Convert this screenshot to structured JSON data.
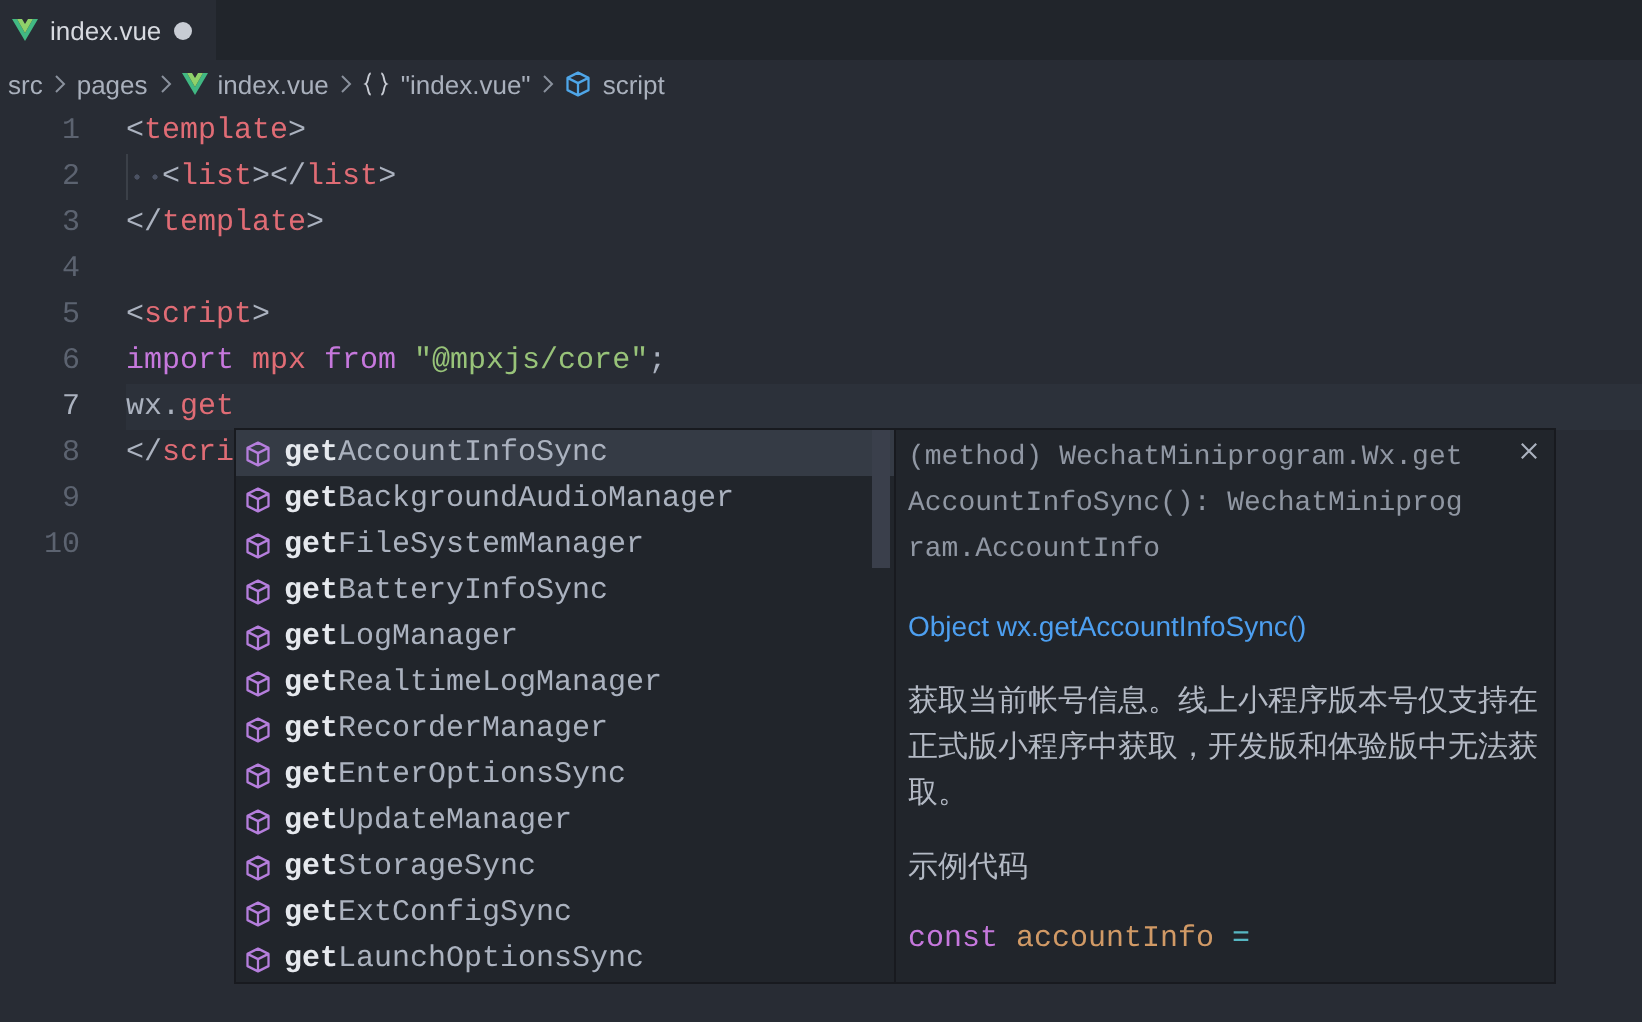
{
  "tabs": [
    {
      "label": "index.vue",
      "selected": true,
      "modified": true
    }
  ],
  "breadcrumb": [
    {
      "kind": "folder",
      "label": "src"
    },
    {
      "kind": "folder",
      "label": "pages"
    },
    {
      "kind": "vue",
      "label": "index.vue"
    },
    {
      "kind": "object",
      "label": "\"index.vue\""
    },
    {
      "kind": "module",
      "label": "script"
    }
  ],
  "code_lines": [
    {
      "number": "1",
      "current": false,
      "indented": false,
      "tokens": [
        {
          "kind": "punct",
          "text": "<"
        },
        {
          "kind": "tag",
          "text": "template"
        },
        {
          "kind": "punct",
          "text": ">"
        }
      ]
    },
    {
      "number": "2",
      "current": false,
      "indented": true,
      "tokens": [
        {
          "kind": "punct",
          "text": "<"
        },
        {
          "kind": "tag",
          "text": "list"
        },
        {
          "kind": "punct",
          "text": "></"
        },
        {
          "kind": "tag",
          "text": "list"
        },
        {
          "kind": "punct",
          "text": ">"
        }
      ]
    },
    {
      "number": "3",
      "current": false,
      "indented": false,
      "tokens": [
        {
          "kind": "punct",
          "text": "</"
        },
        {
          "kind": "tag",
          "text": "template"
        },
        {
          "kind": "punct",
          "text": ">"
        }
      ]
    },
    {
      "number": "4",
      "current": false
    },
    {
      "number": "5",
      "current": false,
      "indented": false,
      "tokens": [
        {
          "kind": "punct",
          "text": "<"
        },
        {
          "kind": "tag",
          "text": "script"
        },
        {
          "kind": "punct",
          "text": ">"
        }
      ]
    },
    {
      "number": "6",
      "current": false,
      "indented": false,
      "tokens": [
        {
          "kind": "keyword",
          "text": "import "
        },
        {
          "kind": "variable",
          "text": "mpx "
        },
        {
          "kind": "keyword",
          "text": "from "
        },
        {
          "kind": "string",
          "text": "\"@mpxjs/core\""
        },
        {
          "kind": "punct",
          "text": ";"
        }
      ]
    },
    {
      "number": "7",
      "current": true,
      "indented": false,
      "tokens": [
        {
          "kind": "plain",
          "text": "wx."
        },
        {
          "kind": "variable",
          "text": "get"
        }
      ]
    },
    {
      "number": "8",
      "current": false,
      "indented": false,
      "tokens": [
        {
          "kind": "punct",
          "text": "</"
        },
        {
          "kind": "tag",
          "text": "scri"
        }
      ]
    },
    {
      "number": "9",
      "current": false
    },
    {
      "number": "10",
      "current": false
    }
  ],
  "suggestions": [
    {
      "match": "get",
      "rest": "AccountInfoSync",
      "selected": true
    },
    {
      "match": "get",
      "rest": "BackgroundAudioManager",
      "selected": false
    },
    {
      "match": "get",
      "rest": "FileSystemManager",
      "selected": false
    },
    {
      "match": "get",
      "rest": "BatteryInfoSync",
      "selected": false
    },
    {
      "match": "get",
      "rest": "LogManager",
      "selected": false
    },
    {
      "match": "get",
      "rest": "RealtimeLogManager",
      "selected": false
    },
    {
      "match": "get",
      "rest": "RecorderManager",
      "selected": false
    },
    {
      "match": "get",
      "rest": "EnterOptionsSync",
      "selected": false
    },
    {
      "match": "get",
      "rest": "UpdateManager",
      "selected": false
    },
    {
      "match": "get",
      "rest": "StorageSync",
      "selected": false
    },
    {
      "match": "get",
      "rest": "ExtConfigSync",
      "selected": false
    },
    {
      "match": "get",
      "rest": "LaunchOptionsSync",
      "selected": false
    }
  ],
  "details": {
    "signature_lines": [
      "(method) WechatMiniprogram.Wx.get",
      "AccountInfoSync(): WechatMiniprog",
      "ram.AccountInfo"
    ],
    "link": "Object wx.getAccountInfoSync()",
    "description": "获取当前帐号信息。线上小程序版本号仅支持在正式版小程序中获取，开发版和体验版中无法获取。",
    "heading": "示例代码",
    "example_tokens": [
      {
        "kind": "keyword",
        "text": "const "
      },
      {
        "kind": "constant",
        "text": "accountInfo "
      },
      {
        "kind": "operator",
        "text": "="
      }
    ]
  }
}
